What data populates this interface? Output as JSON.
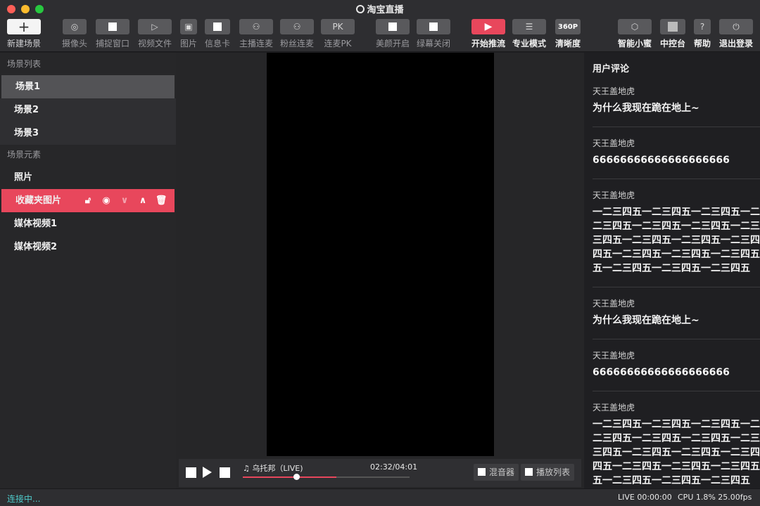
{
  "window": {
    "title": "淘宝直播"
  },
  "toolbar": {
    "new_scene": "新建场景",
    "camera": "摄像头",
    "capture_window": "捕捉窗口",
    "video_file": "视频文件",
    "image": "图片",
    "info_card": "信息卡",
    "anchor_connect": "主播连麦",
    "fan_connect": "粉丝连麦",
    "connect_pk": "连麦PK",
    "pk_icon": "PK",
    "beauty_on": "美颜开启",
    "greenscreen_off": "绿幕关闭",
    "start_stream": "开始推流",
    "pro_mode": "专业模式",
    "resolution": "清晰度",
    "resolution_value": "360P",
    "assistant": "智能小蜜",
    "console": "中控台",
    "help": "帮助",
    "logout": "退出登录"
  },
  "left": {
    "scene_list_title": "场景列表",
    "scenes": [
      "场景1",
      "场景2",
      "场景3"
    ],
    "elements_title": "场景元素",
    "elements": [
      "照片",
      "收藏夹图片",
      "媒体视频1",
      "媒体视频2"
    ]
  },
  "player": {
    "song": "乌托邦（LIVE)",
    "time": "02:32/04:01",
    "progress": 0.56,
    "mixer": "混音器",
    "playlist": "播放列表"
  },
  "comments": {
    "title": "用户评论",
    "items": [
      {
        "user": "天王盖地虎",
        "lines": [
          "为什么我现在跪在地上~"
        ]
      },
      {
        "user": "天王盖地虎",
        "lines": [
          "66666666666666666666"
        ]
      },
      {
        "user": "天王盖地虎",
        "lines": [
          "一二三四五一二三四五一二三四五一二",
          "二三四五一二三四五一二三四五一二三",
          "三四五一二三四五一二三四五一二三四",
          "四五一二三四五一二三四五一二三四五",
          "五一二三四五一二三四五一二三四五"
        ]
      },
      {
        "user": "天王盖地虎",
        "lines": [
          "为什么我现在跪在地上~"
        ]
      },
      {
        "user": "天王盖地虎",
        "lines": [
          "66666666666666666666"
        ]
      },
      {
        "user": "天王盖地虎",
        "lines": [
          "一二三四五一二三四五一二三四五一二",
          "二三四五一二三四五一二三四五一二三",
          "三四五一二三四五一二三四五一二三四",
          "四五一二三四五一二三四五一二三四五",
          "五一二三四五一二三四五一二三四五"
        ]
      }
    ]
  },
  "status": {
    "connection": "连接中...",
    "live": "LIVE 00:00:00",
    "cpu": "CPU 1.8% 25.00fps"
  },
  "colors": {
    "accent": "#e8475c",
    "status_text": "#4ec9c9"
  }
}
